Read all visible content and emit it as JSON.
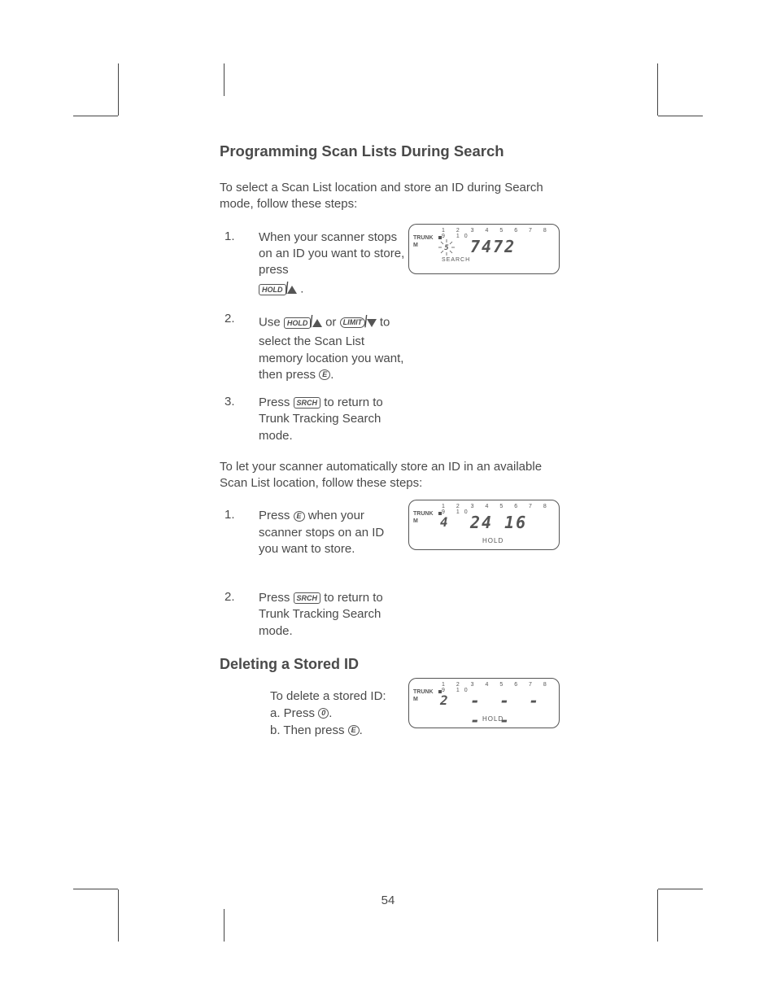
{
  "heading1": "Programming Scan Lists During Search",
  "intro1": "To select a Scan List location and store an ID during Search mode, follow these steps:",
  "steps_a": [
    {
      "num": "1.",
      "text_start": "When your scanner stops on an ID you want to store, press",
      "text_end": "."
    },
    {
      "num": "2.",
      "text_start": "Use",
      "text_mid": "or",
      "text_after": "to select the Scan List memory location you want, then press",
      "text_end": "."
    },
    {
      "num": "3.",
      "text_start": "Press",
      "text_after": "to return to Trunk Tracking Search mode."
    }
  ],
  "intro2": "To let your scanner automatically store an ID in an available Scan List location, follow these steps:",
  "steps_b": [
    {
      "num": "1.",
      "text_start": "Press",
      "text_after": "when your scanner stops on an ID you want to store."
    },
    {
      "num": "2.",
      "text_start": "Press",
      "text_after": "to return to Trunk Tracking Search mode."
    }
  ],
  "heading2": "Deleting a Stored ID",
  "delete_intro": "To delete a stored ID:",
  "delete_a": "a. Press",
  "delete_b": "b. Then press",
  "delete_end": ".",
  "buttons": {
    "hold": "HOLD",
    "limit": "LIMIT",
    "srch": "SRCH",
    "e": "E",
    "zero": "0"
  },
  "screens": {
    "s1": {
      "trunk": "TRUNK",
      "m": "M",
      "nums": "1 2 3 4 5 6 7 8 9 10",
      "sub": "5",
      "main": "7472",
      "bottom": "SEARCH"
    },
    "s2": {
      "trunk": "TRUNK",
      "m": "M",
      "nums": "1 2 3 4 5 6 7 8 9 10",
      "sub": "4",
      "main": "24 16",
      "bottom": "HOLD"
    },
    "s3": {
      "trunk": "TRUNK",
      "m": "M",
      "nums": "1 2 3 4 5 6 7 8 9 10",
      "sub": "2",
      "main": "-----",
      "bottom": "HOLD"
    }
  },
  "page_number": "54"
}
